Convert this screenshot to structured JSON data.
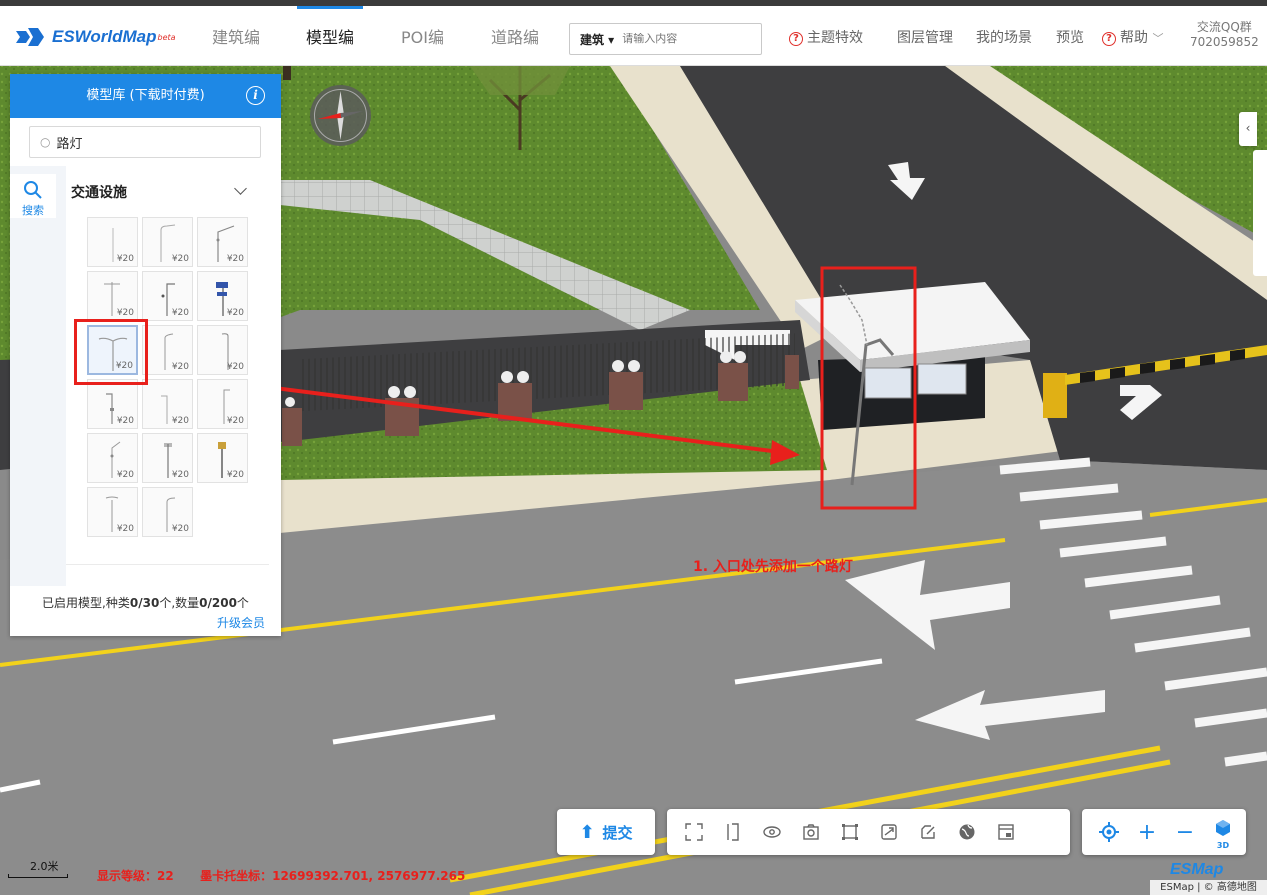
{
  "brand": {
    "name": "ESWorldMap",
    "badge": "beta"
  },
  "nav": [
    {
      "label": "建筑编",
      "active": false
    },
    {
      "label": "模型编",
      "active": true
    },
    {
      "label": "POI编",
      "active": false
    },
    {
      "label": "道路编",
      "active": false
    }
  ],
  "search": {
    "type": "建筑 ▾",
    "placeholder": "请输入内容"
  },
  "top_right": {
    "theme": "主题特效",
    "layers": "图层管理",
    "scenes": "我的场景",
    "preview": "预览",
    "help": "帮助",
    "qq_label": "交流QQ群",
    "qq_number": "702059852"
  },
  "panel": {
    "title": "模型库 (下载时付费)",
    "search_value": "路灯",
    "rail_tab": "搜索",
    "category": "交通设施",
    "price": "¥20",
    "thumbs": [
      {
        "kind": "plain"
      },
      {
        "kind": "arm-left"
      },
      {
        "kind": "arm-right"
      },
      {
        "kind": "double-short"
      },
      {
        "kind": "single-arm"
      },
      {
        "kind": "solar"
      },
      {
        "kind": "double-y",
        "selected": true
      },
      {
        "kind": "curved"
      },
      {
        "kind": "hook"
      },
      {
        "kind": "plain2"
      },
      {
        "kind": "short-arm"
      },
      {
        "kind": "tall-arm"
      },
      {
        "kind": "angled"
      },
      {
        "kind": "top-cap"
      },
      {
        "kind": "lantern"
      },
      {
        "kind": "double-arm"
      },
      {
        "kind": "bent"
      }
    ],
    "footer": {
      "prefix": "已启用模型,种类",
      "kinds": "0/30",
      "mid": "个,数量",
      "count": "0/200",
      "suffix": "个"
    },
    "upgrade": "升级会员"
  },
  "annotation": "1. 入口处先添加一个路灯",
  "toolbar": {
    "submit": "提交"
  },
  "status": {
    "level_label": "显示等级：",
    "level": "22",
    "coord_label": "墨卡托坐标：",
    "coords": "12699392.701, 2576977.265"
  },
  "scale": "2.0米",
  "footer_logo": "ESMap",
  "attribution": "ESMap | © 高德地图",
  "colors": {
    "accent": "#1e88e5",
    "highlight": "#e8201c"
  }
}
